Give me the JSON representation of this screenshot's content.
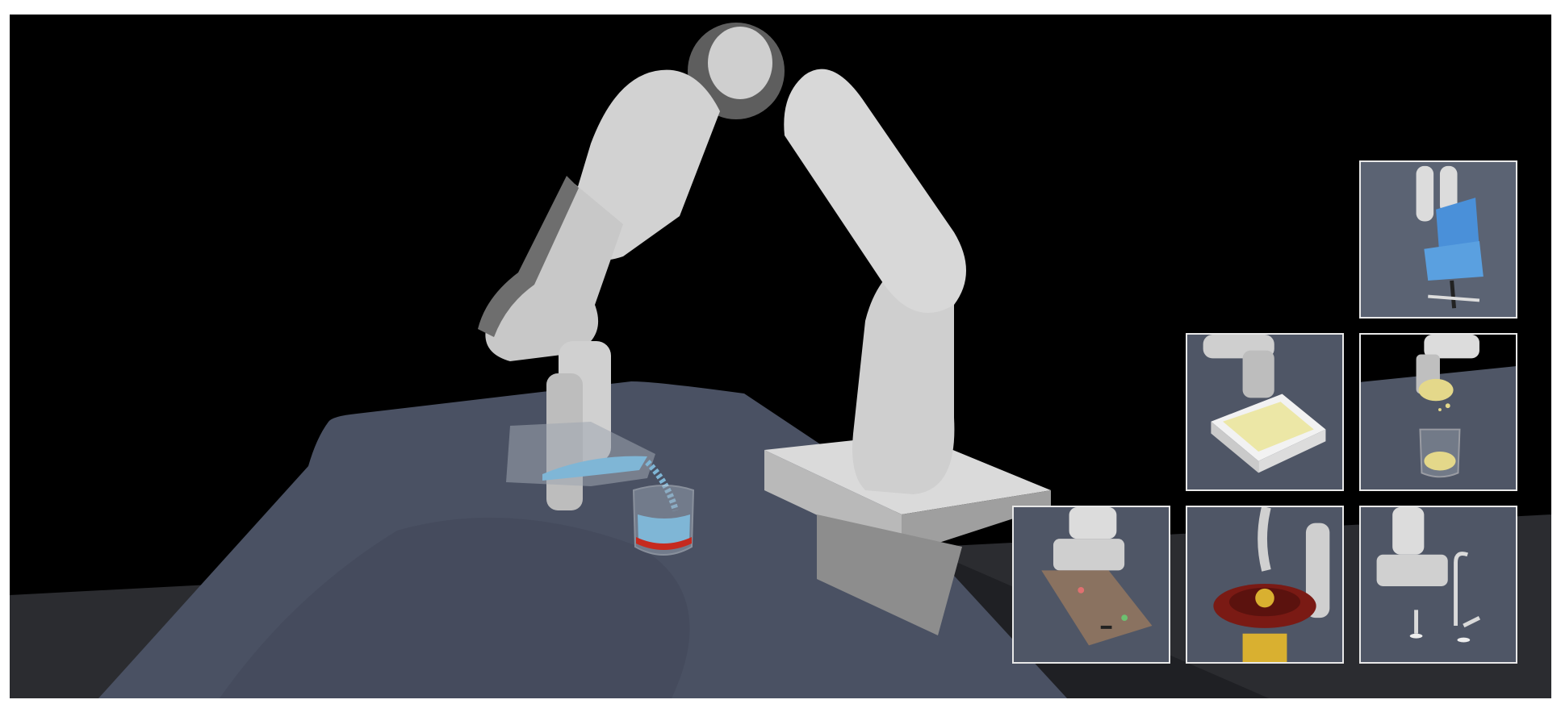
{
  "scene": {
    "main_view": "robot-arm-pouring-liquid",
    "colors": {
      "background": "#000000",
      "table": "#4a5163",
      "floor": "#2e2f33",
      "robot": "#d4d4d4",
      "robot_dark": "#6b6b6b",
      "liquid": "#7fb6d6",
      "beaker_band": "#c62a1f"
    }
  },
  "thumbnails": [
    {
      "name": "thumb-chair-task",
      "scene": "dual-arm-robot-with-blue-office-chair",
      "accent": "#5aa0e0"
    },
    {
      "name": "thumb-dough-tray-task",
      "scene": "robot-pressing-yellow-dough-in-white-tray",
      "accent": "#ece7a6"
    },
    {
      "name": "thumb-granular-pour-task",
      "scene": "robot-pouring-yellow-granules-into-glass",
      "accent": "#e4d88a"
    },
    {
      "name": "thumb-cutting-board-task",
      "scene": "robot-on-wooden-board-with-small-objects",
      "accent": "#8a7260"
    },
    {
      "name": "thumb-bowl-ball-task",
      "scene": "robot-with-ball-on-red-dish",
      "accent": "#7a1a14"
    },
    {
      "name": "thumb-faucet-task",
      "scene": "robot-with-faucets",
      "accent": "#d8d8d8"
    }
  ]
}
